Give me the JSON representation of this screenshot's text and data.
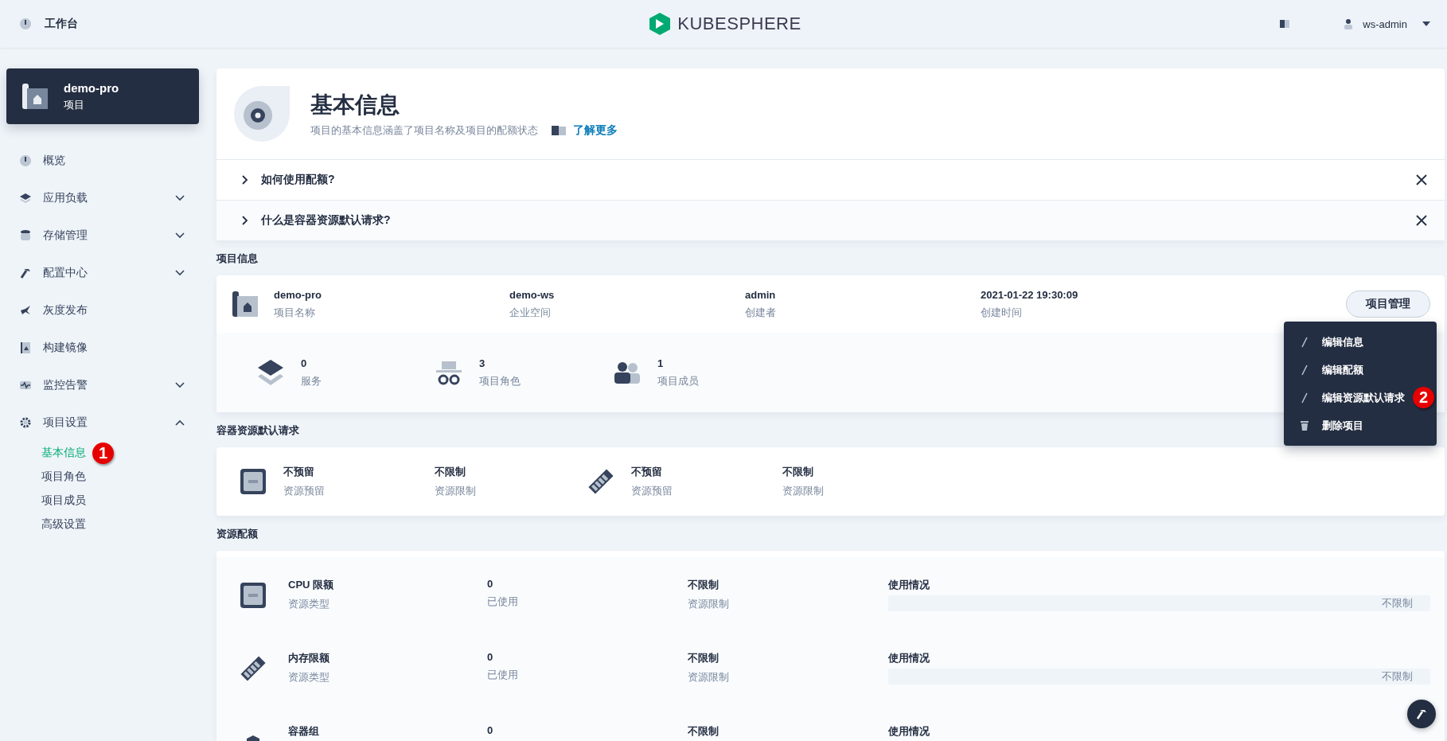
{
  "topbar": {
    "workbench": "工作台",
    "logo": "KUBESPHERE",
    "user": "ws-admin"
  },
  "project_card": {
    "name": "demo-pro",
    "type": "项目"
  },
  "nav": [
    {
      "kind": "link",
      "label": "概览"
    },
    {
      "kind": "group",
      "label": "应用负载",
      "expanded": false
    },
    {
      "kind": "group",
      "label": "存储管理",
      "expanded": false
    },
    {
      "kind": "group",
      "label": "配置中心",
      "expanded": false
    },
    {
      "kind": "link",
      "label": "灰度发布"
    },
    {
      "kind": "link",
      "label": "构建镜像"
    },
    {
      "kind": "group",
      "label": "监控告警",
      "expanded": false
    },
    {
      "kind": "group",
      "label": "项目设置",
      "expanded": true,
      "children": [
        {
          "label": "基本信息",
          "selected": true,
          "annotation": "1"
        },
        {
          "label": "项目角色",
          "selected": false
        },
        {
          "label": "项目成员",
          "selected": false
        },
        {
          "label": "高级设置",
          "selected": false
        }
      ]
    }
  ],
  "header": {
    "title": "基本信息",
    "description": "项目的基本信息涵盖了项目名称及项目的配额状态",
    "link": "了解更多"
  },
  "faq": [
    {
      "question": "如何使用配额?",
      "expanded": false
    },
    {
      "question": "什么是容器资源默认请求?",
      "expanded": false
    }
  ],
  "project_info": {
    "title": "项目信息",
    "fields": [
      {
        "value": "demo-pro",
        "label": "项目名称"
      },
      {
        "value": "demo-ws",
        "label": "企业空间"
      },
      {
        "value": "admin",
        "label": "创建者"
      },
      {
        "value": "2021-01-22 19:30:09",
        "label": "创建时间"
      }
    ],
    "stats": [
      {
        "value": "0",
        "label": "服务"
      },
      {
        "value": "3",
        "label": "项目角色"
      },
      {
        "value": "1",
        "label": "项目成员"
      }
    ],
    "manage_button": "项目管理",
    "menu": [
      {
        "kind": "edit",
        "label": "编辑信息"
      },
      {
        "kind": "edit",
        "label": "编辑配额"
      },
      {
        "kind": "edit",
        "label": "编辑资源默认请求",
        "annotation": "2"
      },
      {
        "kind": "delete",
        "label": "删除项目"
      }
    ]
  },
  "default_requests": {
    "title": "容器资源默认请求",
    "items": [
      {
        "kind": "cpu",
        "request": "不预留",
        "request_label": "资源预留",
        "limit": "不限制",
        "limit_label": "资源限制"
      },
      {
        "kind": "memory",
        "request": "不预留",
        "request_label": "资源预留",
        "limit": "不限制",
        "limit_label": "资源限制"
      }
    ]
  },
  "quotas": {
    "title": "资源配额",
    "rows": [
      {
        "kind": "cpu",
        "name": "CPU 限额",
        "name_label": "资源类型",
        "used": "0",
        "used_label": "已使用",
        "limit": "不限制",
        "limit_label": "资源限制",
        "usage_title": "使用情况",
        "level": 0,
        "usage_text": "不限制"
      },
      {
        "kind": "memory",
        "name": "内存限额",
        "name_label": "资源类型",
        "used": "0",
        "used_label": "已使用",
        "limit": "不限制",
        "limit_label": "资源限制",
        "usage_title": "使用情况",
        "level": 0,
        "usage_text": "不限制"
      },
      {
        "kind": "pod",
        "name": "容器组",
        "used": "0",
        "limit": "不限制",
        "usage_title": "使用情况"
      }
    ]
  }
}
